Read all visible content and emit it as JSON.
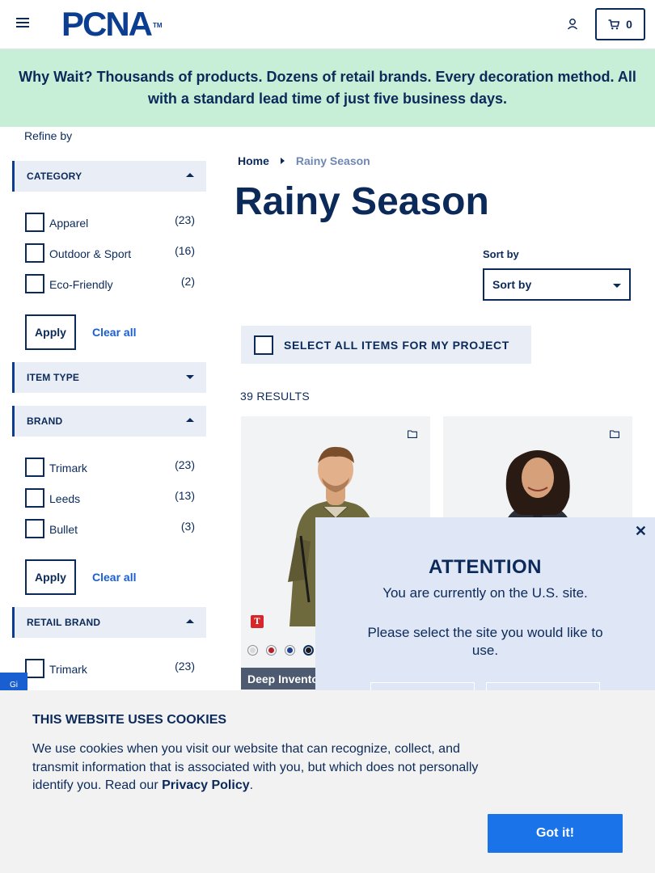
{
  "header": {
    "logo_text": "PCNA",
    "logo_tm": "TM",
    "cart_count": "0"
  },
  "banner": {
    "text": "Why Wait? Thousands of products. Dozens of retail brands. Every decoration method. All with a standard lead time of just five business days."
  },
  "sidebar": {
    "refine_label": "Refine by",
    "category": {
      "title": "CATEGORY",
      "items": [
        {
          "label": "Apparel",
          "count": "(23)"
        },
        {
          "label": "Outdoor & Sport",
          "count": "(16)"
        },
        {
          "label": "Eco-Friendly",
          "count": "(2)"
        }
      ],
      "apply": "Apply",
      "clear": "Clear all"
    },
    "item_type": {
      "title": "ITEM TYPE"
    },
    "brand": {
      "title": "BRAND",
      "items": [
        {
          "label": "Trimark",
          "count": "(23)"
        },
        {
          "label": "Leeds",
          "count": "(13)"
        },
        {
          "label": "Bullet",
          "count": "(3)"
        }
      ],
      "apply": "Apply",
      "clear": "Clear all"
    },
    "retail_brand": {
      "title": "RETAIL BRAND",
      "items": [
        {
          "label": "Trimark",
          "count": "(23)"
        }
      ]
    }
  },
  "breadcrumb": {
    "home": "Home",
    "current": "Rainy Season"
  },
  "page_title": "Rainy Season",
  "sort": {
    "label": "Sort by",
    "value": "Sort by"
  },
  "select_all_label": "SELECT ALL ITEMS FOR MY PROJECT",
  "results_count": "39 RESULTS",
  "products": [
    {
      "badge": "T",
      "swatch_colors": [
        "#d9d9d9",
        "#b3202a",
        "#1d3f8c",
        "#1a1a1a"
      ],
      "tag": "Deep Invento"
    },
    {
      "badge": "",
      "swatch_colors": [],
      "tag": ""
    }
  ],
  "modal": {
    "title": "ATTENTION",
    "subtitle": "You are currently on the U.S. site.",
    "question": "Please select the site you would like to use."
  },
  "side_tab": "Gi",
  "cookie": {
    "title": "THIS WEBSITE USES COOKIES",
    "text_before": "We use cookies when you visit our website that can recognize, collect, and transmit information that is associated with you, but which does not personally identify you. Read our ",
    "link": "Privacy Policy",
    "text_after": ".",
    "button": "Got it!"
  },
  "colors": {
    "navy": "#0b2a5a",
    "banner_bg": "#c7eed6",
    "accent_blue": "#1a73e8"
  }
}
